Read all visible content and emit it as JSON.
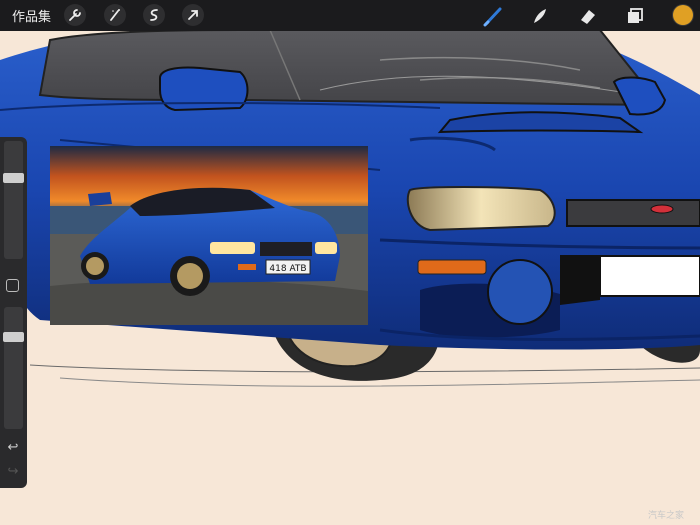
{
  "toolbar": {
    "gallery_label": "作品集",
    "left_tools": [
      "wrench-icon",
      "magic-wand-icon",
      "selection-icon",
      "transform-arrow-icon"
    ],
    "right_tools": [
      "brush-icon",
      "smudge-icon",
      "eraser-icon",
      "layers-icon"
    ],
    "active_tool": "brush-icon",
    "current_color": "#e0a024",
    "active_color": "#2f7ad8"
  },
  "sidebar": {
    "brush_size": 0.3,
    "opacity": 0.78,
    "modifier_icon": "square-icon",
    "undo_icon": "undo-arrow-icon",
    "redo_icon": "redo-arrow-icon"
  },
  "reference": {
    "plate_text": "418 ATB"
  },
  "watermark": "汽车之家"
}
